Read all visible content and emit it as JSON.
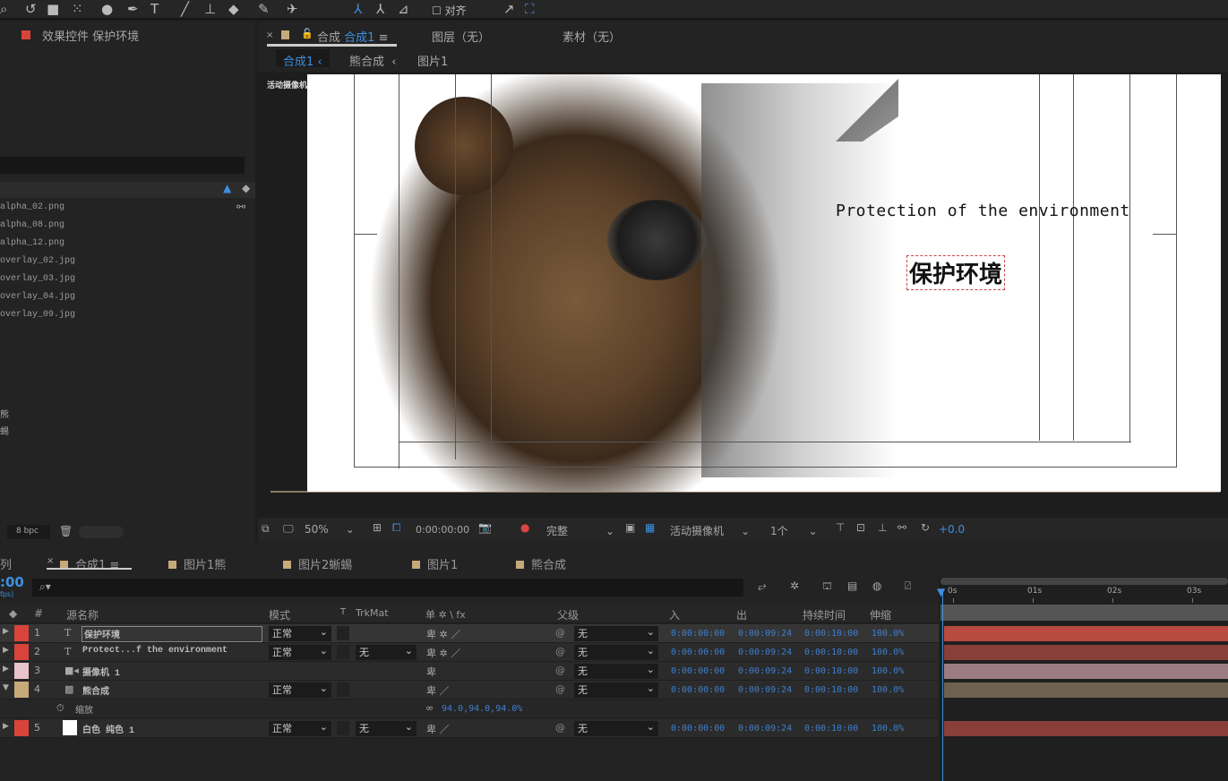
{
  "toolbar": {
    "align_label": "对齐",
    "icons": [
      "zoom-icon",
      "rotate-icon",
      "camera-icon",
      "pan-behind-icon",
      "ellipse-icon",
      "pen-icon",
      "text-icon",
      "brush-icon",
      "stamp-icon",
      "eraser-icon",
      "roto-brush-icon",
      "puppet-pin-icon"
    ]
  },
  "effects_panel": {
    "title": "效果控件 保护环境",
    "color": "#d9443a"
  },
  "project": {
    "files": [
      "alpha_02.png",
      "alpha_08.png",
      "alpha_12.png",
      "overlay_02.jpg",
      "overlay_03.jpg",
      "overlay_04.jpg",
      "overlay_09.jpg"
    ],
    "folders": [
      "熊",
      "蜥蜴"
    ],
    "bpc": "8 bpc"
  },
  "viewer": {
    "tab_prefix": "合成",
    "tab_comp": "合成1",
    "layer_tab": "图层（无）",
    "footage_tab": "素材（无）",
    "breadcrumbs": [
      "合成1",
      "熊合成",
      "图片1"
    ],
    "camera_label": "活动摄像机",
    "comp_text_en": "Protection of the environment",
    "comp_text_cn": "保护环境",
    "bottom": {
      "zoom": "50%",
      "timecode": "0:00:00:00",
      "quality": "完整",
      "view": "活动摄像机",
      "views_count": "1个",
      "exposure": "+0.0"
    }
  },
  "timeline": {
    "left_tab": "列",
    "tabs": [
      "合成1",
      "图片1熊",
      "图片2蜥蜴",
      "图片1",
      "熊合成"
    ],
    "timecode": ":00",
    "fps": "fps)",
    "columns": {
      "name": "源名称",
      "mode": "模式",
      "t": "T",
      "trkmat": "TrkMat",
      "switches": "单 ✲ \\ fx",
      "parent": "父级",
      "in": "入",
      "out": "出",
      "duration": "持续时间",
      "stretch": "伸缩"
    },
    "ruler": [
      "0s",
      "01s",
      "02s",
      "03s"
    ],
    "layers": [
      {
        "num": "1",
        "type": "T",
        "name": "保护环境",
        "color": "#d9443a",
        "mode": "正常",
        "trkmat": "",
        "parent": "无",
        "in": "0:00:00:00",
        "out": "0:00:09:24",
        "dur": "0:00:10:00",
        "stretch": "100.0%",
        "bar": "#b84a40"
      },
      {
        "num": "2",
        "type": "T",
        "name": "Protect...f the environment",
        "color": "#d9443a",
        "mode": "正常",
        "trkmat": "无",
        "parent": "无",
        "in": "0:00:00:00",
        "out": "0:00:09:24",
        "dur": "0:00:10:00",
        "stretch": "100.0%",
        "bar": "#8a3e3a"
      },
      {
        "num": "3",
        "type": "cam",
        "name": "摄像机 1",
        "color": "#e8c4cc",
        "mode": "",
        "trkmat": "",
        "parent": "无",
        "in": "0:00:00:00",
        "out": "0:00:09:24",
        "dur": "0:00:10:00",
        "stretch": "100.0%",
        "bar": "#9c7c84"
      },
      {
        "num": "4",
        "type": "comp",
        "name": "熊合成",
        "color": "#c7a97a",
        "mode": "正常",
        "trkmat": "",
        "parent": "无",
        "in": "0:00:00:00",
        "out": "0:00:09:24",
        "dur": "0:00:10:00",
        "stretch": "100.0%",
        "bar": "#6e6150"
      },
      {
        "num": "5",
        "type": "solid",
        "name": "白色 纯色 1",
        "color": "#d9443a",
        "mode": "正常",
        "trkmat": "无",
        "parent": "无",
        "in": "0:00:00:00",
        "out": "0:00:09:24",
        "dur": "0:00:10:00",
        "stretch": "100.0%",
        "bar": "#8a3e3a"
      }
    ],
    "property": {
      "name": "缩放",
      "value": "94.0,94.0,94.0%"
    }
  }
}
